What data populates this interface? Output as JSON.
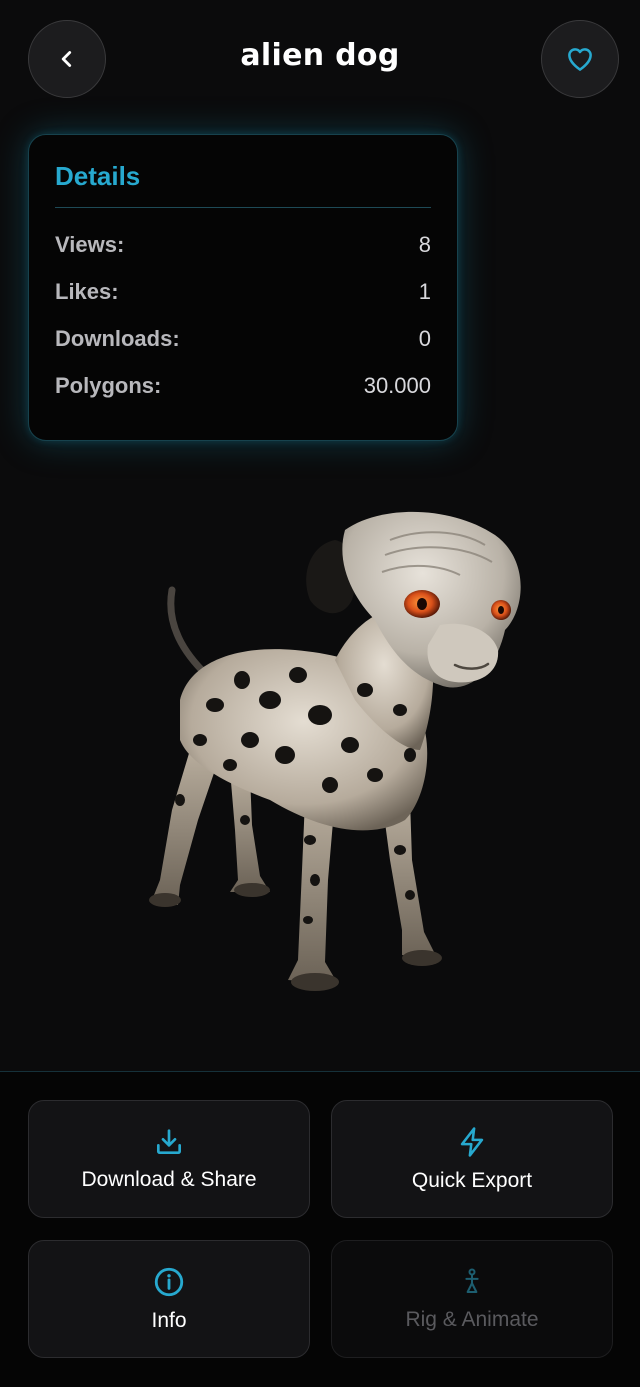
{
  "header": {
    "title": "alien dog",
    "back_icon": "chevron-left-icon",
    "favorite_icon": "heart-icon"
  },
  "details": {
    "title": "Details",
    "stats": [
      {
        "label": "Views:",
        "value": "8"
      },
      {
        "label": "Likes:",
        "value": "1"
      },
      {
        "label": "Downloads:",
        "value": "0"
      },
      {
        "label": "Polygons:",
        "value": "30.000"
      }
    ]
  },
  "actions": {
    "download": {
      "label": "Download & Share",
      "icon": "download-icon"
    },
    "export": {
      "label": "Quick Export",
      "icon": "lightning-icon"
    },
    "info": {
      "label": "Info",
      "icon": "info-icon"
    },
    "rig": {
      "label": "Rig & Animate",
      "icon": "rig-icon",
      "enabled": false
    }
  },
  "colors": {
    "accent": "#27a9cf",
    "background": "#0b0b0c",
    "panel": "#131315"
  }
}
